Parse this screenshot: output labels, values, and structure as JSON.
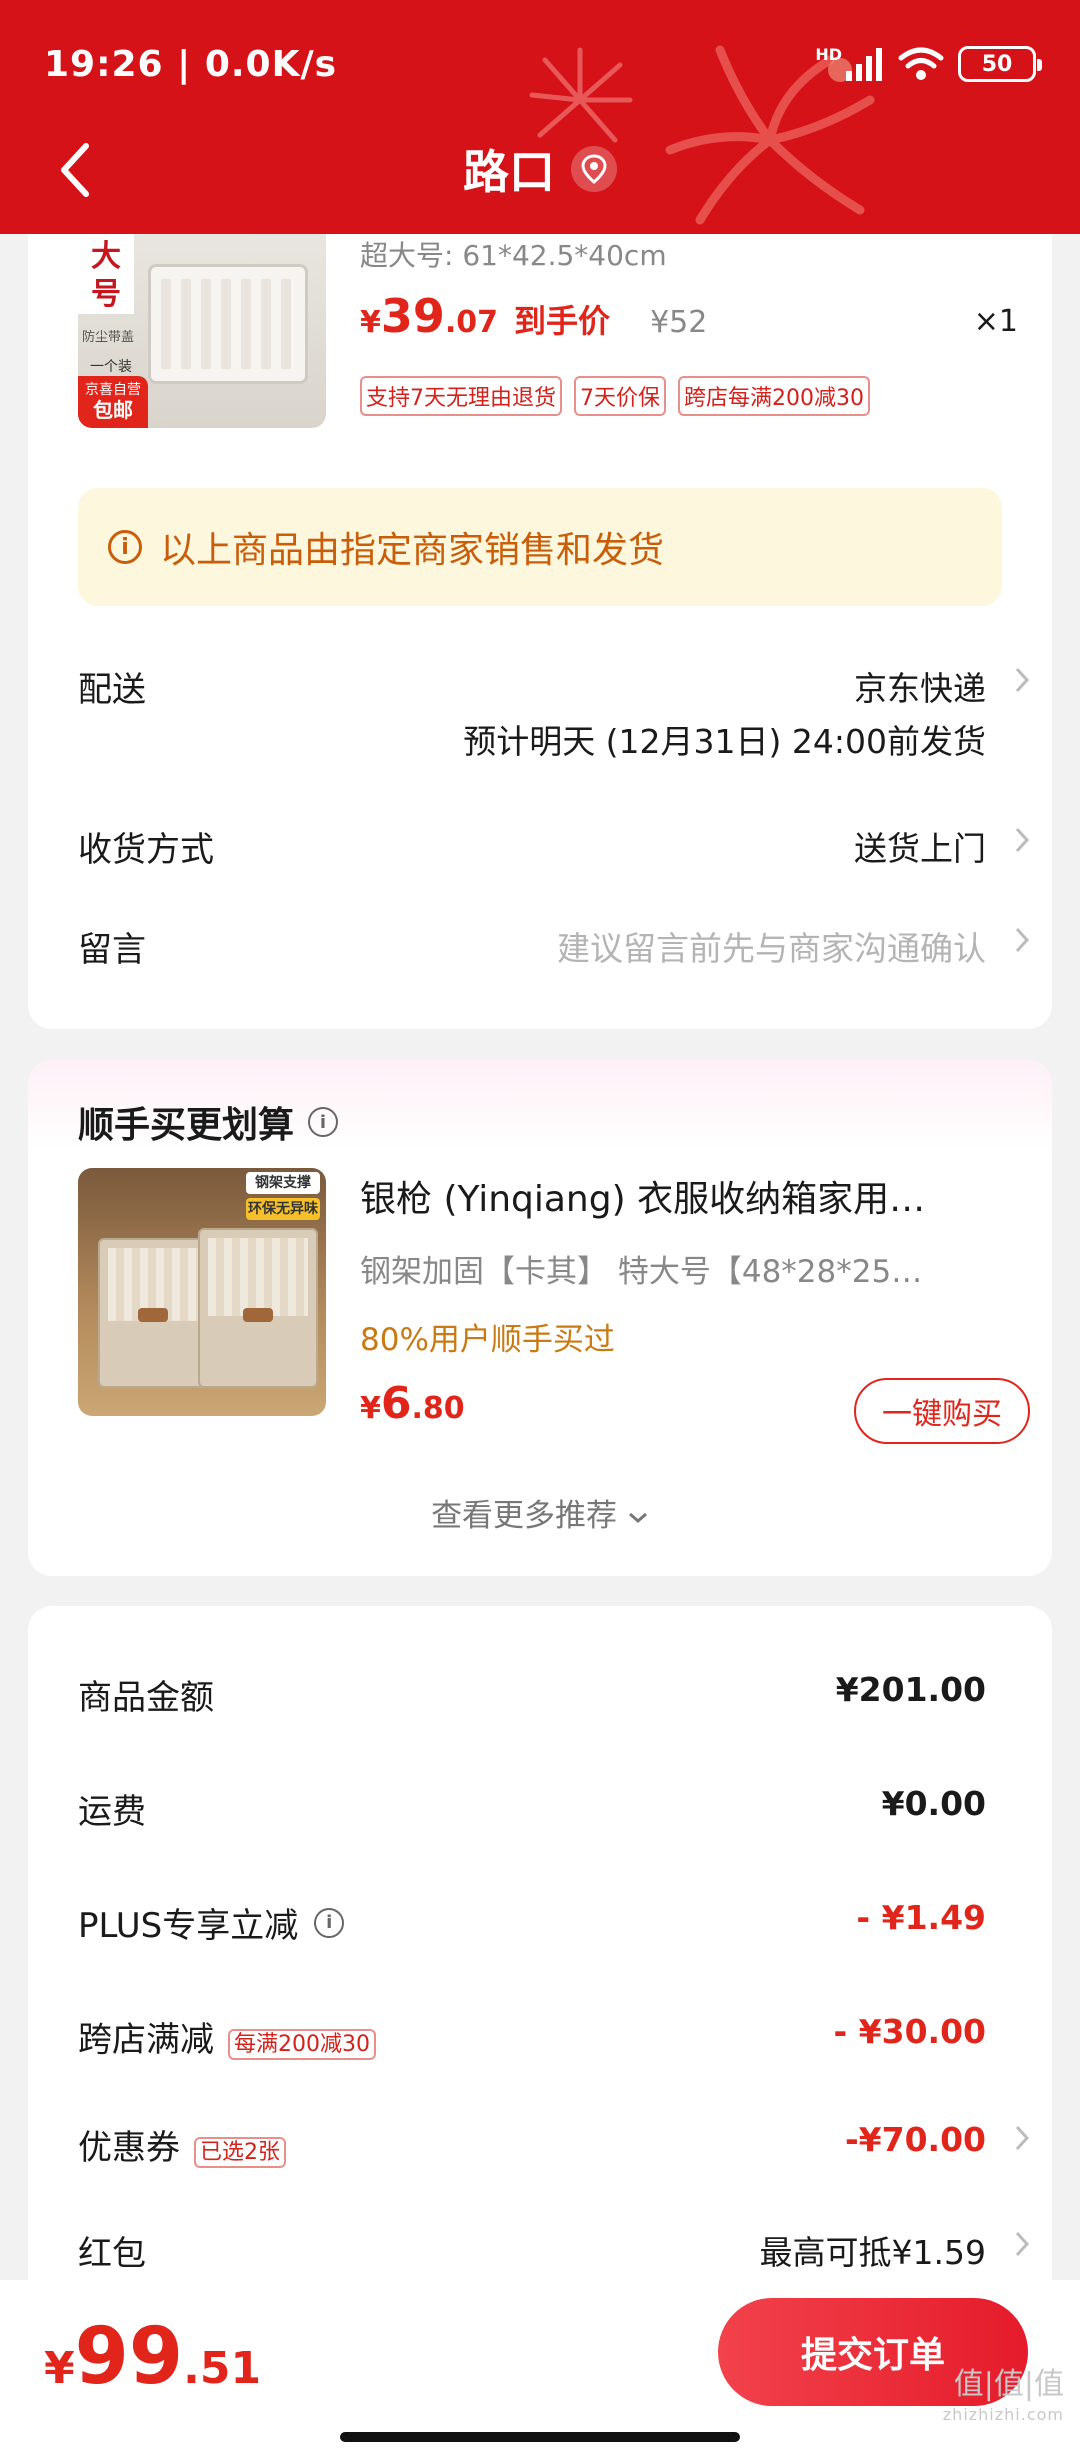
{
  "status_bar": {
    "time": "19:26",
    "network_speed": "0.0K/s",
    "battery": "50",
    "network_label": "HD"
  },
  "nav": {
    "title": "路口"
  },
  "product": {
    "image_size_label": "大号",
    "image_sub": "防尘带盖",
    "image_qty_label": "一个装",
    "image_badge_top": "京喜自营",
    "image_badge_bottom": "包邮",
    "spec": "超大号: 61*42.5*40cm",
    "price_yen": "¥",
    "price_int": "39",
    "price_dec": ".07",
    "price_label": "到手价",
    "original_price": "¥52",
    "quantity": "×1",
    "tags": [
      "支持7天无理由退货",
      "7天价保",
      "跨店每满200减30"
    ]
  },
  "notice": {
    "text": "以上商品由指定商家销售和发货"
  },
  "delivery": {
    "label": "配送",
    "carrier": "京东快递",
    "eta": "预计明天 (12月31日) 24:00前发货"
  },
  "receive_method": {
    "label": "收货方式",
    "value": "送货上门"
  },
  "message": {
    "label": "留言",
    "placeholder": "建议留言前先与商家沟通确认"
  },
  "recommend": {
    "section_title": "顺手买更划算",
    "item_title": "银枪 (Yinqiang) 衣服收纳箱家用…",
    "item_spec": "钢架加固【卡其】   特大号【48*28*25…",
    "item_hint": "80%用户顺手买过",
    "image_sticker_1": "钢架支撑",
    "image_sticker_2": "环保无异味",
    "price_yen": "¥",
    "price_int": "6",
    "price_dec": ".80",
    "buy_button": "一键购买",
    "more_label": "查看更多推荐"
  },
  "summary": {
    "goods_amount_label": "商品金额",
    "goods_amount": "¥201.00",
    "shipping_label": "运费",
    "shipping": "¥0.00",
    "plus_label": "PLUS专享立减",
    "plus_discount": "- ¥1.49",
    "cross_store_label": "跨店满减",
    "cross_store_tag": "每满200减30",
    "cross_store_discount": "- ¥30.00",
    "coupon_label": "优惠券",
    "coupon_tag": "已选2张",
    "coupon_discount": "-¥70.00",
    "redpacket_label": "红包",
    "redpacket_value": "最高可抵¥1.59"
  },
  "bottom": {
    "total_yen": "¥",
    "total_int": "99",
    "total_dec": ".51",
    "submit_button": "提交订单"
  },
  "watermark": {
    "text": "值|值|值",
    "sub": "zhizhizhi.com"
  },
  "colors": {
    "header_red": "#d41217",
    "accent_red": "#e1251b",
    "notice_bg": "#fdf7dd",
    "notice_text": "#c85d0a",
    "hint_orange": "#c97a12"
  }
}
